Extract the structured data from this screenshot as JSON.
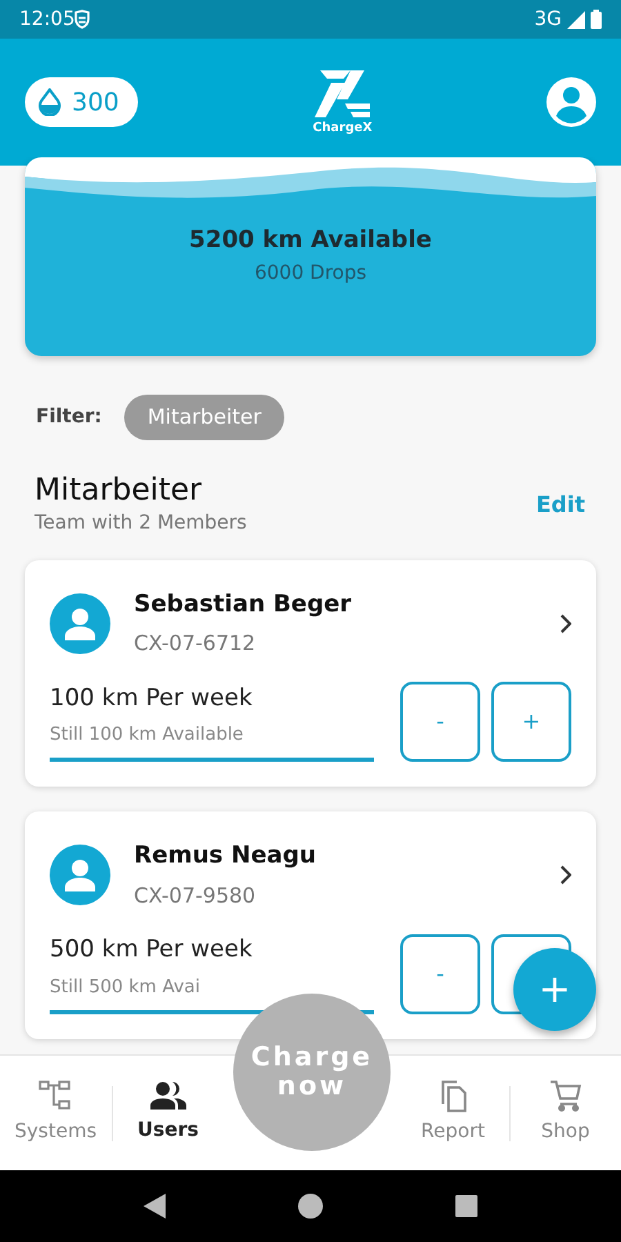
{
  "status_bar": {
    "time": "12:05",
    "network": "3G"
  },
  "header": {
    "drops": "300",
    "logo_text": "ChargeX"
  },
  "summary": {
    "distance": "5200 km Available",
    "drops": "6000 Drops"
  },
  "filter": {
    "label": "Filter:",
    "chip": "Mitarbeiter"
  },
  "team": {
    "title": "Mitarbeiter",
    "subtitle": "Team with 2 Members",
    "edit": "Edit"
  },
  "members": [
    {
      "name": "Sebastian Beger",
      "id": "CX-07-6712",
      "allowance": "100 km Per week",
      "remaining": "Still 100 km Available",
      "minus": "-",
      "plus": "+"
    },
    {
      "name": "Remus Neagu",
      "id": "CX-07-9580",
      "allowance": "500 km Per week",
      "remaining": "Still 500 km Avai",
      "minus": "-"
    }
  ],
  "fab": "+",
  "charge_button": "Charge now",
  "bottom_nav": [
    {
      "label": "Systems",
      "kind": "systems",
      "selected": false
    },
    {
      "label": "Users",
      "kind": "users",
      "selected": true
    },
    {
      "label": "Report",
      "kind": "report",
      "selected": false
    },
    {
      "label": "Shop",
      "kind": "shop",
      "selected": false
    }
  ]
}
